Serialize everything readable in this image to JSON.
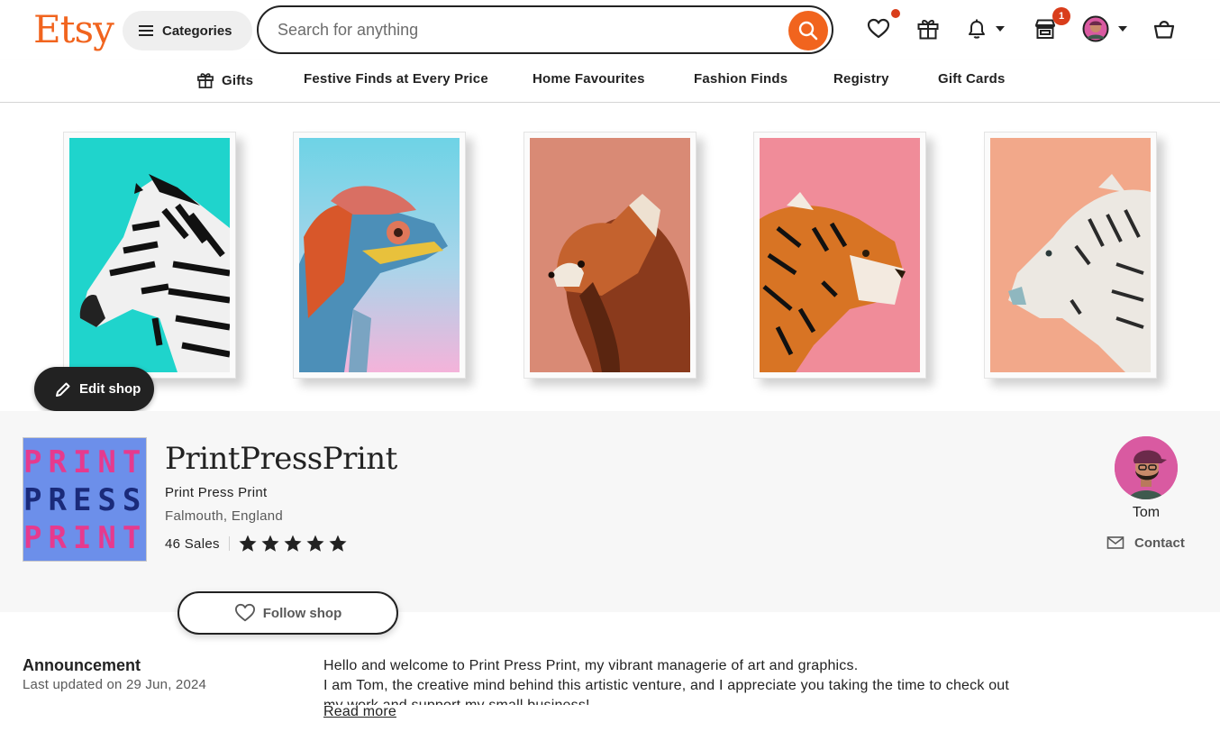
{
  "header": {
    "logo": "Etsy",
    "categories_label": "Categories",
    "search_placeholder": "Search for anything",
    "cart_badge": "1",
    "brand_color": "#F1641E"
  },
  "nav": {
    "items": [
      {
        "label": "Gifts",
        "icon": "gift-icon"
      },
      {
        "label": "Festive Finds at Every Price"
      },
      {
        "label": "Home Favourites"
      },
      {
        "label": "Fashion Finds"
      },
      {
        "label": "Registry"
      },
      {
        "label": "Gift Cards"
      }
    ]
  },
  "banner": {
    "prints": [
      {
        "subject": "zebra",
        "bg": "#1FD4CC"
      },
      {
        "subject": "chameleon",
        "bg": "#8ED3E0"
      },
      {
        "subject": "red panda",
        "bg": "#D98A75"
      },
      {
        "subject": "tiger",
        "bg": "#F08C99"
      },
      {
        "subject": "white tiger",
        "bg": "#F2A88A"
      }
    ],
    "edit_shop_label": "Edit shop"
  },
  "shop": {
    "logo_lines": [
      "PRINT",
      "PRESS",
      "PRINT"
    ],
    "name": "PrintPressPrint",
    "tagline": "Print Press Print",
    "location": "Falmouth, England",
    "sales": "46 Sales",
    "rating": 5,
    "follow_label": "Follow shop"
  },
  "owner": {
    "name": "Tom",
    "contact_label": "Contact"
  },
  "announcement": {
    "title": "Announcement",
    "updated": "Last updated on 29 Jun, 2024",
    "line1": "Hello and welcome to Print Press Print, my vibrant managerie of art and graphics.",
    "line2": "I am Tom, the creative mind behind this artistic venture, and I appreciate you taking the time to check out",
    "line3": "my work and support my small business!",
    "read_more": "Read more"
  }
}
